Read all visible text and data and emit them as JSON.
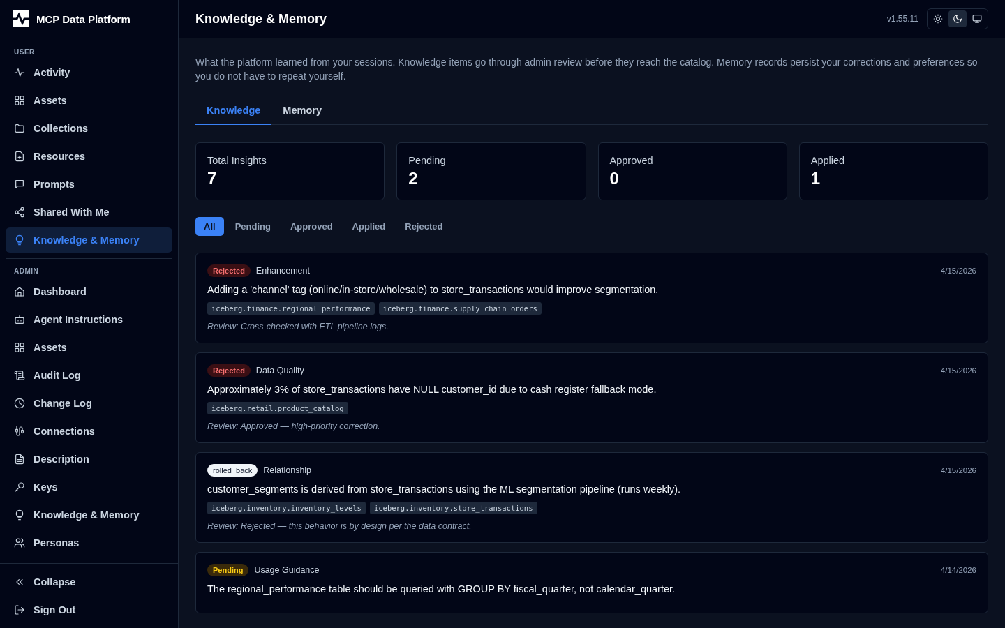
{
  "brand": {
    "name": "MCP Data Platform"
  },
  "sidebar": {
    "sections": [
      {
        "heading": "USER",
        "items": [
          {
            "label": "Activity",
            "selected": false
          },
          {
            "label": "Assets",
            "selected": false
          },
          {
            "label": "Collections",
            "selected": false
          },
          {
            "label": "Resources",
            "selected": false
          },
          {
            "label": "Prompts",
            "selected": false
          },
          {
            "label": "Shared With Me",
            "selected": false
          },
          {
            "label": "Knowledge & Memory",
            "selected": true
          }
        ]
      },
      {
        "heading": "ADMIN",
        "items": [
          {
            "label": "Dashboard",
            "selected": false
          },
          {
            "label": "Agent Instructions",
            "selected": false
          },
          {
            "label": "Assets",
            "selected": false
          },
          {
            "label": "Audit Log",
            "selected": false
          },
          {
            "label": "Change Log",
            "selected": false
          },
          {
            "label": "Connections",
            "selected": false
          },
          {
            "label": "Description",
            "selected": false
          },
          {
            "label": "Keys",
            "selected": false
          },
          {
            "label": "Knowledge & Memory",
            "selected": false
          },
          {
            "label": "Personas",
            "selected": false
          }
        ]
      }
    ],
    "footer": [
      {
        "label": "Collapse"
      },
      {
        "label": "Sign Out"
      }
    ]
  },
  "header": {
    "title": "Knowledge & Memory",
    "version": "v1.55.11",
    "theme_options": [
      {
        "selected": false
      },
      {
        "selected": true
      },
      {
        "selected": false
      }
    ]
  },
  "intro": "What the platform learned from your sessions. Knowledge items go through admin review before they reach the catalog. Memory records persist your corrections and preferences so you do not have to repeat yourself.",
  "tabs": [
    {
      "label": "Knowledge",
      "selected": true
    },
    {
      "label": "Memory",
      "selected": false
    }
  ],
  "stats": [
    {
      "label": "Total Insights",
      "value": "7"
    },
    {
      "label": "Pending",
      "value": "2"
    },
    {
      "label": "Approved",
      "value": "0"
    },
    {
      "label": "Applied",
      "value": "1"
    }
  ],
  "filters": [
    {
      "label": "All",
      "selected": true
    },
    {
      "label": "Pending",
      "selected": false
    },
    {
      "label": "Approved",
      "selected": false
    },
    {
      "label": "Applied",
      "selected": false
    },
    {
      "label": "Rejected",
      "selected": false
    }
  ],
  "insights": [
    {
      "status": {
        "kind": "rejected",
        "label": "Rejected"
      },
      "category": "Enhancement",
      "date": "4/15/2026",
      "text": "Adding a 'channel' tag (online/in-store/wholesale) to store_transactions would improve segmentation.",
      "tables": [
        "iceberg.finance.regional_performance",
        "iceberg.finance.supply_chain_orders"
      ],
      "review": "Review: Cross-checked with ETL pipeline logs."
    },
    {
      "status": {
        "kind": "rejected",
        "label": "Rejected"
      },
      "category": "Data Quality",
      "date": "4/15/2026",
      "text": "Approximately 3% of store_transactions have NULL customer_id due to cash register fallback mode.",
      "tables": [
        "iceberg.retail.product_catalog"
      ],
      "review": "Review: Approved — high-priority correction."
    },
    {
      "status": {
        "kind": "rolled_back",
        "label": "rolled_back"
      },
      "category": "Relationship",
      "date": "4/15/2026",
      "text": "customer_segments is derived from store_transactions using the ML segmentation pipeline (runs weekly).",
      "tables": [
        "iceberg.inventory.inventory_levels",
        "iceberg.inventory.store_transactions"
      ],
      "review": "Review: Rejected — this behavior is by design per the data contract."
    },
    {
      "status": {
        "kind": "pending",
        "label": "Pending"
      },
      "category": "Usage Guidance",
      "date": "4/14/2026",
      "text": "The regional_performance table should be queried with GROUP BY fiscal_quarter, not calendar_quarter."
    }
  ]
}
